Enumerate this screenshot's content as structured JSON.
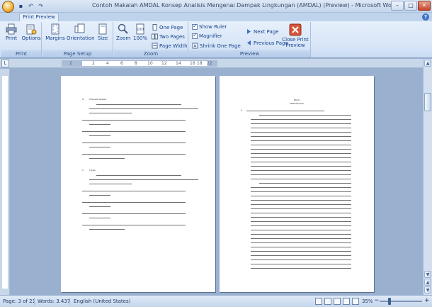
{
  "window": {
    "title": "Contoh Makalah AMDAL Konsep Analisis Mengenai Dampak Lingkungan (AMDAL) (Preview) - Microsoft Word"
  },
  "tabs": {
    "active": "Print Preview"
  },
  "ribbon": {
    "groups": {
      "print": {
        "label": "Print",
        "print": "Print",
        "options": "Options"
      },
      "page_setup": {
        "label": "Page Setup",
        "margins": "Margins",
        "orientation": "Orientation",
        "size": "Size"
      },
      "zoom": {
        "label": "Zoom",
        "zoom": "Zoom",
        "percent": "100%",
        "one_page": "One Page",
        "two_pages": "Two Pages",
        "page_width": "Page Width"
      },
      "preview": {
        "label": "Preview",
        "show_ruler": "Show Ruler",
        "magnifier": "Magnifier",
        "shrink_one_page": "Shrink One Page",
        "next_page": "Next Page",
        "previous_page": "Previous Page",
        "close_preview": "Close Print Preview"
      }
    },
    "checks": {
      "show_ruler": true,
      "magnifier": true
    }
  },
  "ruler": {
    "numbers": [
      "2",
      "2",
      "4",
      "6",
      "8",
      "10",
      "12",
      "14",
      "16",
      "18",
      "22"
    ]
  },
  "pages": {
    "left": {
      "heading_b": "B.",
      "heading_c": "C.",
      "heading_b_text": "Rumusan Masalah",
      "heading_c_text": "Tujuan"
    },
    "right": {
      "bab": "BAB II",
      "title": "PEMBAHASAN",
      "section_a": "A."
    }
  },
  "status": {
    "page": "Page: 3 of 21",
    "words": "Words: 3.437",
    "language": "English (United States)",
    "zoom": "35%"
  },
  "colors": {
    "accent": "#15428b",
    "close": "#c5452a"
  }
}
